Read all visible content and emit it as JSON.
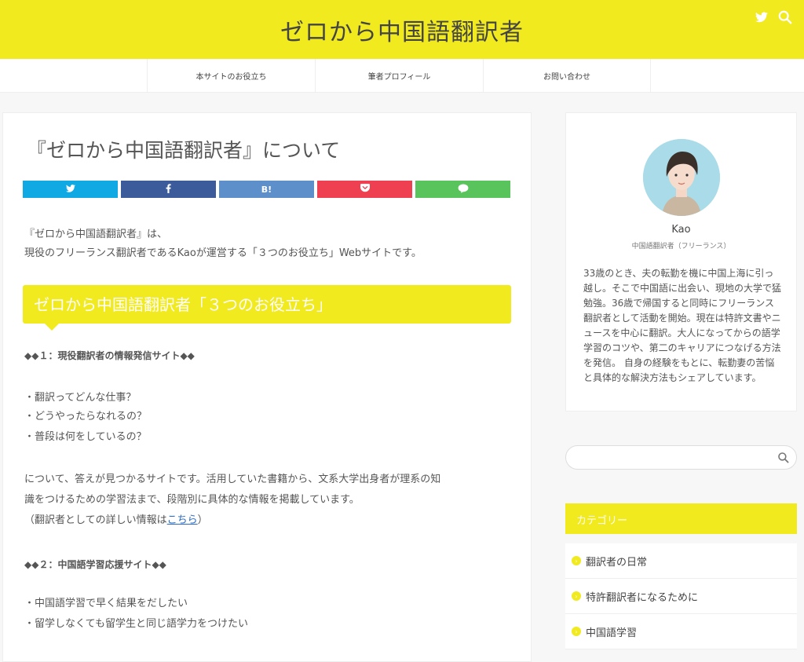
{
  "colors": {
    "accent": "#f0ea1f",
    "twitter": "#10a9e4",
    "facebook": "#3b5b9b",
    "hatena": "#5d8fcb",
    "pocket": "#ee4050",
    "line": "#59c45b"
  },
  "header": {
    "title": "ゼロから中国語翻訳者",
    "icons": [
      "twitter-icon",
      "search-icon"
    ]
  },
  "nav": {
    "items": [
      "本サイトのお役立ち",
      "筆者プロフィール",
      "お問い合わせ"
    ]
  },
  "article": {
    "title": "『ゼロから中国語翻訳者』について",
    "share": {
      "hatena_label": "B!"
    },
    "intro_1": "『ゼロから中国語翻訳者』は、",
    "intro_2": "現役のフリーランス翻訳者であるKaoが運営する「３つのお役立ち」Webサイトです。",
    "section_heading": "ゼロから中国語翻訳者「３つのお役立ち」",
    "sub1": "◆◆１：現役翻訳者の情報発信サイト◆◆",
    "list1": [
      "・翻訳ってどんな仕事？",
      "・どうやったらなれるの？",
      "・普段は何をしているの？"
    ],
    "desc_1": "について、答えが見つかるサイトです。活用していた書籍から、文系大学出身者が理系の知",
    "desc_2": "識をつけるための学習法まで、段階別に具体的な情報を掲載しています。",
    "desc_3_pre": "（翻訳者としての詳しい情報は",
    "desc_3_link": "こちら",
    "desc_3_post": "）",
    "sub2": "◆◆２：中国語学習応援サイト◆◆",
    "list2": [
      "・中国語学習で早く結果をだしたい",
      "・留学しなくても留学生と同じ語学力をつけたい"
    ]
  },
  "sidebar": {
    "profile": {
      "name": "Kao",
      "role": "中国語翻訳者（フリーランス）",
      "bio": "33歳のとき、夫の転勤を機に中国上海に引っ越し。そこで中国語に出会い、現地の大学で猛勉強。36歳で帰国すると同時にフリーランス翻訳者として活動を開始。現在は特許文書やニュースを中心に翻訳。大人になってからの語学学習のコツや、第二のキャリアにつなげる方法を発信。 自身の経験をもとに、転勤妻の苦悩と具体的な解決方法もシェアしています。"
    },
    "search": {
      "placeholder": ""
    },
    "categories": {
      "title": "カテゴリー",
      "items": [
        "翻訳者の日常",
        "特許翻訳者になるために",
        "中国語学習"
      ]
    }
  }
}
